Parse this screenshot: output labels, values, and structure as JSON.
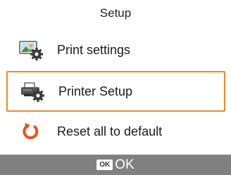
{
  "title": "Setup",
  "menu": {
    "items": [
      {
        "label": "Print settings",
        "icon": "print-settings-icon",
        "selected": false
      },
      {
        "label": "Printer Setup",
        "icon": "printer-setup-icon",
        "selected": true
      },
      {
        "label": "Reset all to default",
        "icon": "reset-icon",
        "selected": false
      }
    ]
  },
  "footer": {
    "ok_badge": "OK",
    "ok_label": "OK"
  },
  "colors": {
    "selection": "#f28a1e",
    "footer_bg": "#808080",
    "reset_icon": "#e8531c",
    "gear": "#3a3a3a"
  }
}
